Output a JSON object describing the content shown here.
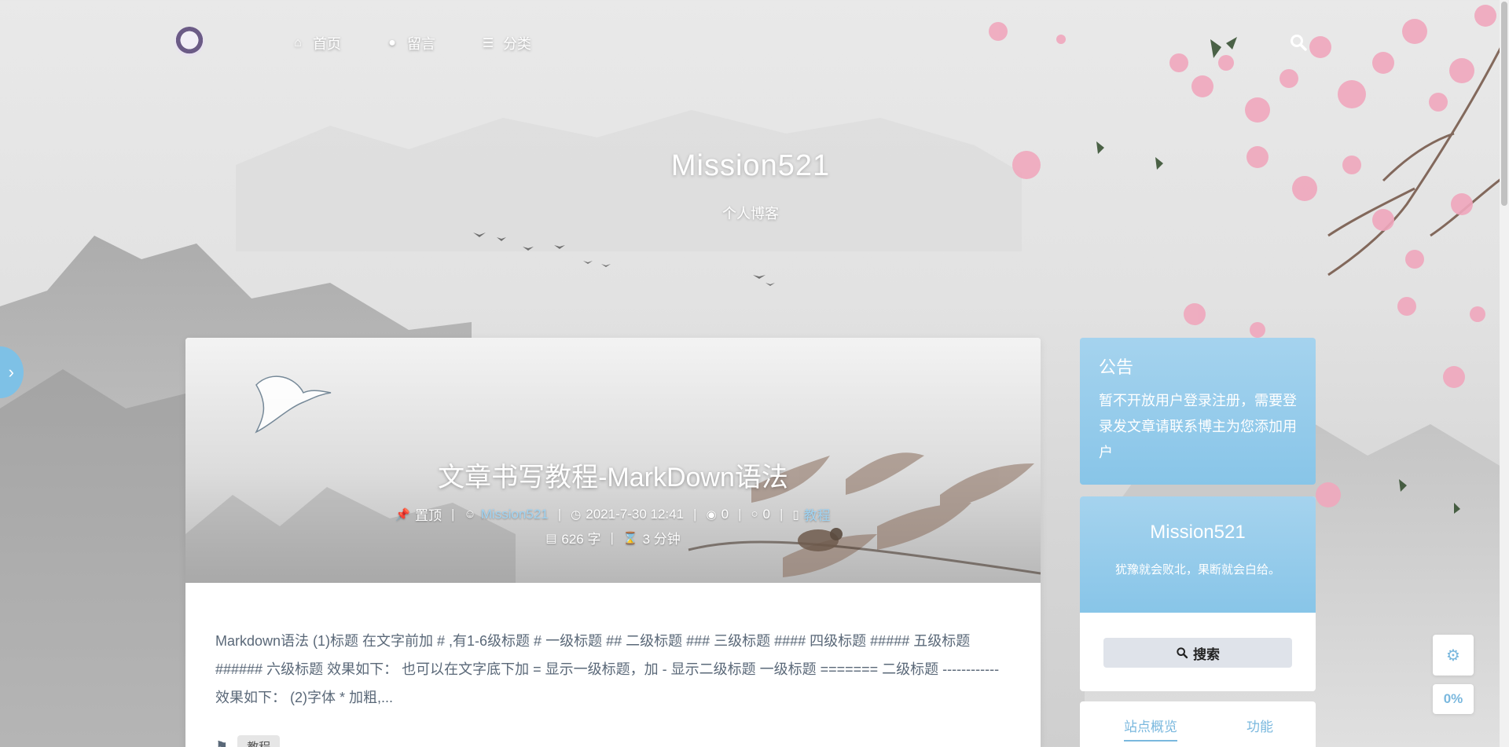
{
  "nav": {
    "items": [
      {
        "label": "首页",
        "icon": "home-icon"
      },
      {
        "label": "留言",
        "icon": "comment-icon"
      },
      {
        "label": "分类",
        "icon": "list-icon"
      }
    ]
  },
  "hero": {
    "title": "Mission521",
    "subtitle": "个人博客"
  },
  "article": {
    "title": "文章书写教程-MarkDown语法",
    "pinned": "置顶",
    "author": "Mission521",
    "date": "2021-7-30 12:41",
    "views": "0",
    "comments": "0",
    "category": "教程",
    "word_count": "626 字",
    "read_time": "3 分钟",
    "excerpt": "Markdown语法 (1)标题 在文字前加 # ,有1-6级标题 # 一级标题 ## 二级标题 ### 三级标题 #### 四级标题 ##### 五级标题 ###### 六级标题 效果如下：  也可以在文字底下加 = 显示一级标题，加 - 显示二级标题 一级标题 ======= 二级标题 ------------ 效果如下：  (2)字体 * 加粗,...",
    "tag": "教程"
  },
  "notice": {
    "title": "公告",
    "text": "暂不开放用户登录注册，需要登录发文章请联系博主为您添加用户"
  },
  "profile": {
    "name": "Mission521",
    "motto": "犹豫就会败北，果断就会白给。",
    "search_label": "搜索"
  },
  "stats": {
    "tabs": [
      "站点概览",
      "功能"
    ]
  },
  "tools": {
    "progress": "0%"
  },
  "colors": {
    "accent": "#7ab8de",
    "notice_bg": "#a5d3ee"
  }
}
